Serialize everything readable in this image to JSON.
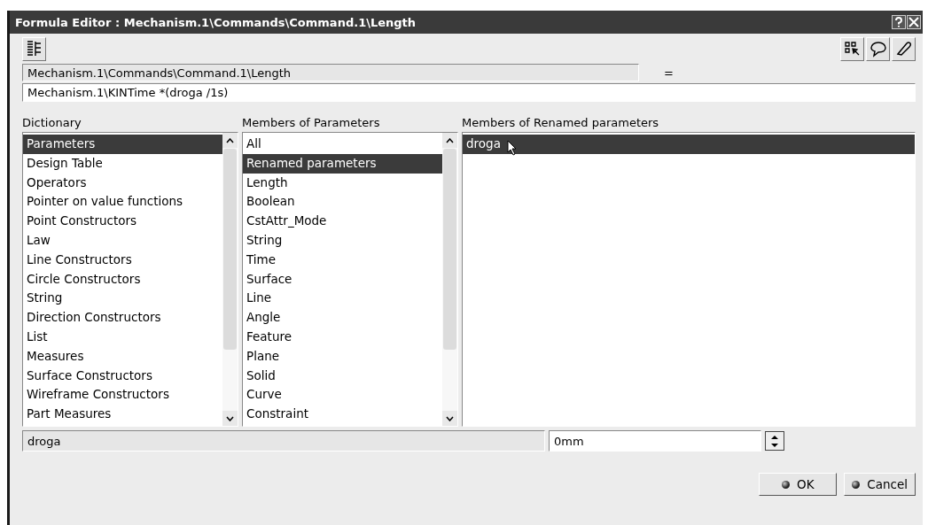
{
  "window": {
    "title": "Formula Editor : Mechanism.1\\Commands\\Command.1\\Length"
  },
  "parameter_path": {
    "value": "Mechanism.1\\Commands\\Command.1\\Length",
    "operator": "="
  },
  "formula": {
    "value": "Mechanism.1\\KINTime *(droga /1s)"
  },
  "dictionary": {
    "label": "Dictionary",
    "items": [
      {
        "label": "Parameters",
        "selected": true
      },
      {
        "label": "Design Table",
        "selected": false
      },
      {
        "label": "Operators",
        "selected": false
      },
      {
        "label": "Pointer on value functions",
        "selected": false
      },
      {
        "label": "Point Constructors",
        "selected": false
      },
      {
        "label": "Law",
        "selected": false
      },
      {
        "label": "Line Constructors",
        "selected": false
      },
      {
        "label": "Circle Constructors",
        "selected": false
      },
      {
        "label": "String",
        "selected": false
      },
      {
        "label": "Direction Constructors",
        "selected": false
      },
      {
        "label": "List",
        "selected": false
      },
      {
        "label": "Measures",
        "selected": false
      },
      {
        "label": "Surface Constructors",
        "selected": false
      },
      {
        "label": "Wireframe Constructors",
        "selected": false
      },
      {
        "label": "Part Measures",
        "selected": false
      }
    ]
  },
  "members": {
    "label": "Members of Parameters",
    "items": [
      {
        "label": "All",
        "selected": false
      },
      {
        "label": "Renamed parameters",
        "selected": true
      },
      {
        "label": "Length",
        "selected": false
      },
      {
        "label": "Boolean",
        "selected": false
      },
      {
        "label": "CstAttr_Mode",
        "selected": false
      },
      {
        "label": "String",
        "selected": false
      },
      {
        "label": "Time",
        "selected": false
      },
      {
        "label": "Surface",
        "selected": false
      },
      {
        "label": "Line",
        "selected": false
      },
      {
        "label": "Angle",
        "selected": false
      },
      {
        "label": "Feature",
        "selected": false
      },
      {
        "label": "Plane",
        "selected": false
      },
      {
        "label": "Solid",
        "selected": false
      },
      {
        "label": "Curve",
        "selected": false
      },
      {
        "label": "Constraint",
        "selected": false
      }
    ]
  },
  "renamed_members": {
    "label": "Members of Renamed parameters",
    "items": [
      {
        "label": "droga",
        "selected": true
      }
    ]
  },
  "selected_name": {
    "value": "droga"
  },
  "selected_value": {
    "value": "0mm"
  },
  "buttons": [
    {
      "label": "OK"
    },
    {
      "label": "Cancel"
    }
  ]
}
